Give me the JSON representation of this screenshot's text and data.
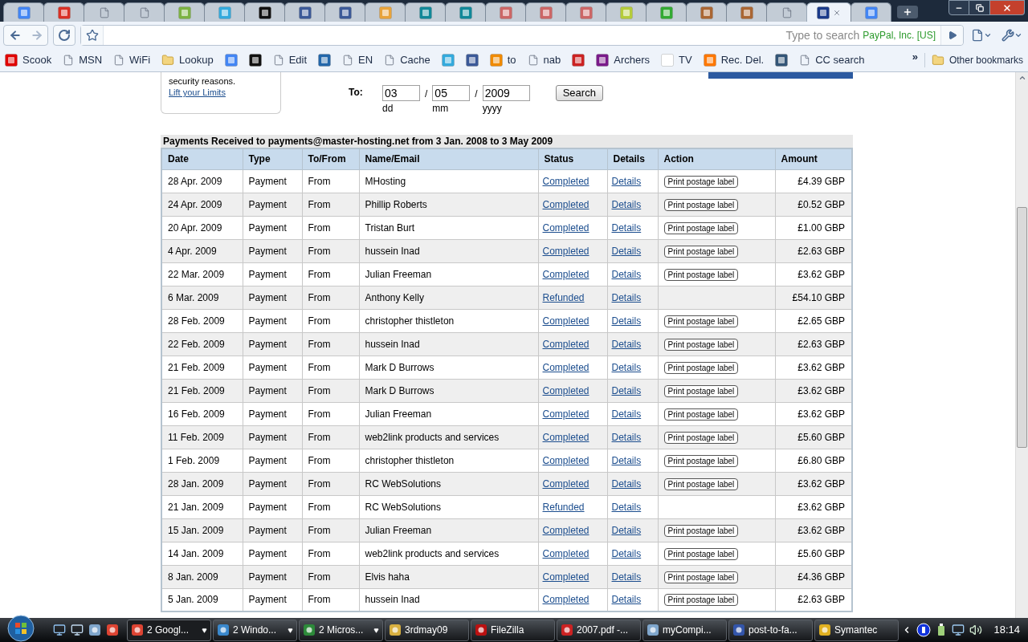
{
  "tabs": [
    {
      "selected": false
    },
    {
      "selected": false
    },
    {
      "selected": false
    },
    {
      "selected": false
    },
    {
      "selected": false
    },
    {
      "selected": false
    },
    {
      "selected": false
    },
    {
      "selected": false
    },
    {
      "selected": false
    },
    {
      "selected": false
    },
    {
      "selected": false
    },
    {
      "selected": false
    },
    {
      "selected": false
    },
    {
      "selected": false
    },
    {
      "selected": false
    },
    {
      "selected": false
    },
    {
      "selected": false
    },
    {
      "selected": false
    },
    {
      "selected": false
    },
    {
      "selected": false
    },
    {
      "selected": true
    },
    {
      "selected": false
    }
  ],
  "toolbar": {
    "back": {
      "disabled": false
    },
    "forward": {
      "disabled": true
    },
    "address": {
      "placeholder": "Type to search",
      "identity": "PayPal, Inc. [US]"
    }
  },
  "bookmarks": [
    {
      "kind": "labeled",
      "label": "Scook"
    },
    {
      "kind": "labeled",
      "label": "MSN"
    },
    {
      "kind": "labeled",
      "label": "WiFi"
    },
    {
      "kind": "labeled",
      "label": "Lookup"
    },
    {
      "kind": "icon"
    },
    {
      "kind": "icon"
    },
    {
      "kind": "labeled",
      "label": "Edit"
    },
    {
      "kind": "icon"
    },
    {
      "kind": "labeled",
      "label": "EN"
    },
    {
      "kind": "labeled",
      "label": "Cache"
    },
    {
      "kind": "icon"
    },
    {
      "kind": "icon"
    },
    {
      "kind": "labeled",
      "label": "to"
    },
    {
      "kind": "labeled",
      "label": "nab"
    },
    {
      "kind": "icon"
    },
    {
      "kind": "labeled",
      "label": "Archers"
    },
    {
      "kind": "labeled",
      "label": "TV"
    },
    {
      "kind": "labeled",
      "label": "Rec. Del."
    },
    {
      "kind": "icon"
    },
    {
      "kind": "labeled",
      "label": "CC search"
    }
  ],
  "bookmarks_more": "»",
  "other_bookmarks": "Other bookmarks",
  "limits_box": {
    "text": "security reasons.",
    "link": "Lift your Limits"
  },
  "date_to": {
    "label": "To:",
    "day": "03",
    "month": "05",
    "year": "2009",
    "separator": "/",
    "day_hint": "dd",
    "month_hint": "mm",
    "year_hint": "yyyy",
    "button": "Search"
  },
  "table": {
    "caption": "Payments Received to payments@master-hosting.net from 3 Jan. 2008 to 3 May 2009",
    "columns": [
      "Date",
      "Type",
      "To/From",
      "Name/Email",
      "Status",
      "Details",
      "Action",
      "Amount"
    ],
    "rows": [
      {
        "date": "28 Apr. 2009",
        "type": "Payment",
        "direction": "From",
        "name": "MHosting",
        "status": "Completed",
        "details": "Details",
        "action": "Print postage label",
        "amount": "£4.39 GBP"
      },
      {
        "date": "24 Apr. 2009",
        "type": "Payment",
        "direction": "From",
        "name": "Phillip Roberts",
        "status": "Completed",
        "details": "Details",
        "action": "Print postage label",
        "amount": "£0.52 GBP"
      },
      {
        "date": "20 Apr. 2009",
        "type": "Payment",
        "direction": "From",
        "name": "Tristan Burt",
        "status": "Completed",
        "details": "Details",
        "action": "Print postage label",
        "amount": "£1.00 GBP"
      },
      {
        "date": "4 Apr. 2009",
        "type": "Payment",
        "direction": "From",
        "name": "hussein Inad",
        "status": "Completed",
        "details": "Details",
        "action": "Print postage label",
        "amount": "£2.63 GBP"
      },
      {
        "date": "22 Mar. 2009",
        "type": "Payment",
        "direction": "From",
        "name": "Julian Freeman",
        "status": "Completed",
        "details": "Details",
        "action": "Print postage label",
        "amount": "£3.62 GBP"
      },
      {
        "date": "6 Mar. 2009",
        "type": "Payment",
        "direction": "From",
        "name": "Anthony Kelly",
        "status": "Refunded",
        "details": "Details",
        "amount": "£54.10 GBP"
      },
      {
        "date": "28 Feb. 2009",
        "type": "Payment",
        "direction": "From",
        "name": "christopher thistleton",
        "status": "Completed",
        "details": "Details",
        "action": "Print postage label",
        "amount": "£2.65 GBP"
      },
      {
        "date": "22 Feb. 2009",
        "type": "Payment",
        "direction": "From",
        "name": "hussein Inad",
        "status": "Completed",
        "details": "Details",
        "action": "Print postage label",
        "amount": "£2.63 GBP"
      },
      {
        "date": "21 Feb. 2009",
        "type": "Payment",
        "direction": "From",
        "name": "Mark D Burrows",
        "status": "Completed",
        "details": "Details",
        "action": "Print postage label",
        "amount": "£3.62 GBP"
      },
      {
        "date": "21 Feb. 2009",
        "type": "Payment",
        "direction": "From",
        "name": "Mark D Burrows",
        "status": "Completed",
        "details": "Details",
        "action": "Print postage label",
        "amount": "£3.62 GBP"
      },
      {
        "date": "16 Feb. 2009",
        "type": "Payment",
        "direction": "From",
        "name": "Julian Freeman",
        "status": "Completed",
        "details": "Details",
        "action": "Print postage label",
        "amount": "£3.62 GBP"
      },
      {
        "date": "11 Feb. 2009",
        "type": "Payment",
        "direction": "From",
        "name": "web2link products and services",
        "status": "Completed",
        "details": "Details",
        "action": "Print postage label",
        "amount": "£5.60 GBP"
      },
      {
        "date": "1 Feb. 2009",
        "type": "Payment",
        "direction": "From",
        "name": "christopher thistleton",
        "status": "Completed",
        "details": "Details",
        "action": "Print postage label",
        "amount": "£6.80 GBP"
      },
      {
        "date": "28 Jan. 2009",
        "type": "Payment",
        "direction": "From",
        "name": "RC WebSolutions",
        "status": "Completed",
        "details": "Details",
        "action": "Print postage label",
        "amount": "£3.62 GBP"
      },
      {
        "date": "21 Jan. 2009",
        "type": "Payment",
        "direction": "From",
        "name": "RC WebSolutions",
        "status": "Refunded",
        "details": "Details",
        "amount": "£3.62 GBP"
      },
      {
        "date": "15 Jan. 2009",
        "type": "Payment",
        "direction": "From",
        "name": "Julian Freeman",
        "status": "Completed",
        "details": "Details",
        "action": "Print postage label",
        "amount": "£3.62 GBP"
      },
      {
        "date": "14 Jan. 2009",
        "type": "Payment",
        "direction": "From",
        "name": "web2link products and services",
        "status": "Completed",
        "details": "Details",
        "action": "Print postage label",
        "amount": "£5.60 GBP"
      },
      {
        "date": "8 Jan. 2009",
        "type": "Payment",
        "direction": "From",
        "name": "Elvis haha",
        "status": "Completed",
        "details": "Details",
        "action": "Print postage label",
        "amount": "£4.36 GBP"
      },
      {
        "date": "5 Jan. 2009",
        "type": "Payment",
        "direction": "From",
        "name": "hussein Inad",
        "status": "Completed",
        "details": "Details",
        "action": "Print postage label",
        "amount": "£2.63 GBP"
      }
    ]
  },
  "taskbar": {
    "tasks": [
      {
        "label": "2 Googl...",
        "grouped": true,
        "selected": true
      },
      {
        "label": "2 Windo...",
        "grouped": true,
        "selected": false
      },
      {
        "label": "2 Micros...",
        "grouped": true,
        "selected": false
      },
      {
        "label": "3rdmay09",
        "grouped": false,
        "selected": false
      },
      {
        "label": "FileZilla",
        "grouped": false,
        "selected": false
      },
      {
        "label": "2007.pdf -...",
        "grouped": false,
        "selected": false
      },
      {
        "label": "myCompi...",
        "grouped": false,
        "selected": false
      },
      {
        "label": "post-to-fa...",
        "grouped": false,
        "selected": false
      },
      {
        "label": "Symantec",
        "grouped": false,
        "selected": false
      }
    ],
    "clock": "18:14"
  }
}
